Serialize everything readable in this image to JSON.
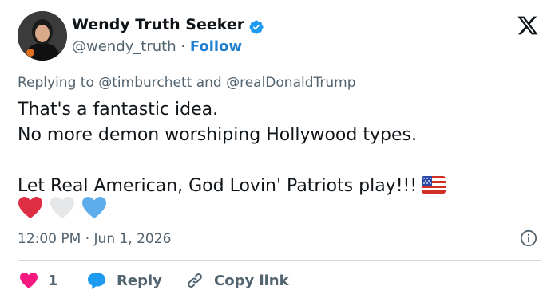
{
  "author": {
    "name": "Wendy Truth Seeker",
    "handle": "@wendy_truth",
    "separator": "·",
    "follow_label": "Follow"
  },
  "replying": {
    "prefix": "Replying to",
    "mention1": "@timburchett",
    "conjunction": "and",
    "mention2": "@realDonaldTrump"
  },
  "tweet": {
    "line1": "That's a fantastic idea.",
    "line2": "No more demon worshiping Hollywood types.",
    "line3": "Let Real American, God Lovin' Patriots play!!!"
  },
  "timestamp": "12:00 PM · Jun 1, 2026",
  "actions": {
    "like_count": "1",
    "reply_label": "Reply",
    "copy_label": "Copy link"
  },
  "icons": {
    "verified": "verified-badge-icon",
    "x_logo": "x-logo-icon",
    "flag": "us-flag-icon",
    "hearts": [
      "red-heart-icon",
      "white-heart-icon",
      "blue-heart-icon"
    ],
    "info": "info-icon"
  },
  "colors": {
    "link": "#1d7fd1",
    "muted": "#536471",
    "verified": "#1d9bf0",
    "like": "#f91880",
    "reply": "#1d9bf0"
  }
}
